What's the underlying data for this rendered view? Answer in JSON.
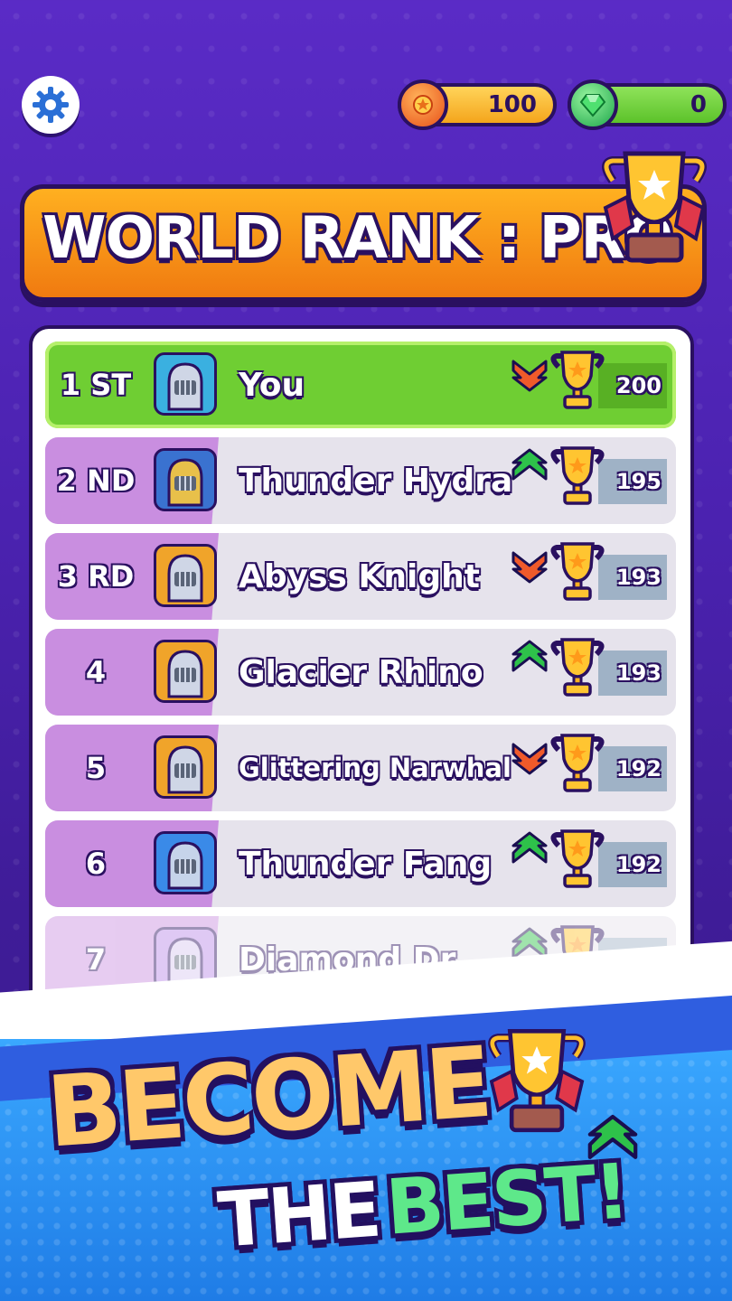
{
  "currency": {
    "coins": "100",
    "gems": "0"
  },
  "banner": {
    "title": "WORLD RANK : PRO"
  },
  "leaderboard": [
    {
      "rank": "1 ST",
      "name": "You",
      "trend": "down",
      "score": "200"
    },
    {
      "rank": "2 ND",
      "name": "Thunder Hydra",
      "trend": "up",
      "score": "195"
    },
    {
      "rank": "3 RD",
      "name": "Abyss Knight",
      "trend": "down",
      "score": "193"
    },
    {
      "rank": "4",
      "name": "Glacier Rhino",
      "trend": "up",
      "score": "193"
    },
    {
      "rank": "5",
      "name": "Glittering Narwhal",
      "trend": "down",
      "score": "192"
    },
    {
      "rank": "6",
      "name": "Thunder Fang",
      "trend": "up",
      "score": "192"
    },
    {
      "rank": "7",
      "name": "Diamond Dr...",
      "trend": "up",
      "score": ""
    }
  ],
  "promo": {
    "line1": "BECOME",
    "line2a": "THE",
    "line2b": "BEST!"
  },
  "icons": {
    "settings": "gear-icon",
    "coin": "coin-icon",
    "gem": "gem-icon",
    "trophy": "trophy-icon",
    "rank_up": "chevron-up-icon",
    "rank_down": "chevron-down-icon"
  },
  "colors": {
    "background": "#4b22b0",
    "you_row": "#6fce33",
    "rank_cell": "#c98ee0",
    "banner": "#f39a18",
    "rank_up": "#2ec24a",
    "rank_down": "#f05a2a",
    "outline": "#2a1060"
  }
}
